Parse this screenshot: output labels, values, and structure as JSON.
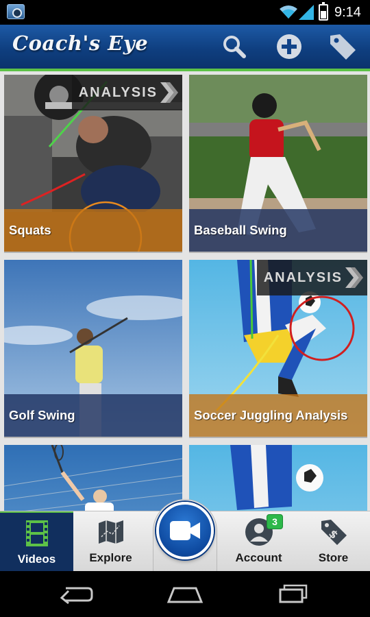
{
  "status_bar": {
    "time": "9:14",
    "icons": [
      "app-notification-icon",
      "wifi-icon",
      "cell-signal-icon",
      "battery-icon"
    ]
  },
  "header": {
    "title": "Coach's Eye",
    "actions": [
      {
        "name": "search",
        "icon": "search-icon"
      },
      {
        "name": "add",
        "icon": "plus-icon"
      },
      {
        "name": "tags",
        "icon": "tag-icon"
      }
    ]
  },
  "videos": [
    {
      "title": "Squats",
      "badge": "ANALYSIS",
      "label_style": "orange"
    },
    {
      "title": "Baseball Swing",
      "badge": "",
      "label_style": "blue"
    },
    {
      "title": "Golf Swing",
      "badge": "",
      "label_style": "blue"
    },
    {
      "title": "Soccer Juggling Analysis",
      "badge": "ANALYSIS",
      "label_style": "orange"
    },
    {
      "title": "",
      "badge": "",
      "label_style": ""
    },
    {
      "title": "",
      "badge": "",
      "label_style": ""
    }
  ],
  "bottom_nav": {
    "items": [
      {
        "label": "Videos",
        "icon": "film-strip-icon",
        "active": true
      },
      {
        "label": "Explore",
        "icon": "map-icon",
        "active": false
      },
      {
        "label": "Account",
        "icon": "person-icon",
        "badge": "3",
        "active": false
      },
      {
        "label": "Store",
        "icon": "price-tag-dollar-icon",
        "active": false
      }
    ],
    "record_icon": "video-camera-icon"
  },
  "system_nav": [
    "back-icon",
    "home-icon",
    "recent-apps-icon"
  ],
  "colors": {
    "header_blue": "#0f3f80",
    "accent_green": "#5dc247",
    "label_orange": "#c47314",
    "label_navy": "#1e3260",
    "active_tab": "#112f5e",
    "record_blue": "#0e4aa0",
    "badge_green": "#2db84a"
  }
}
